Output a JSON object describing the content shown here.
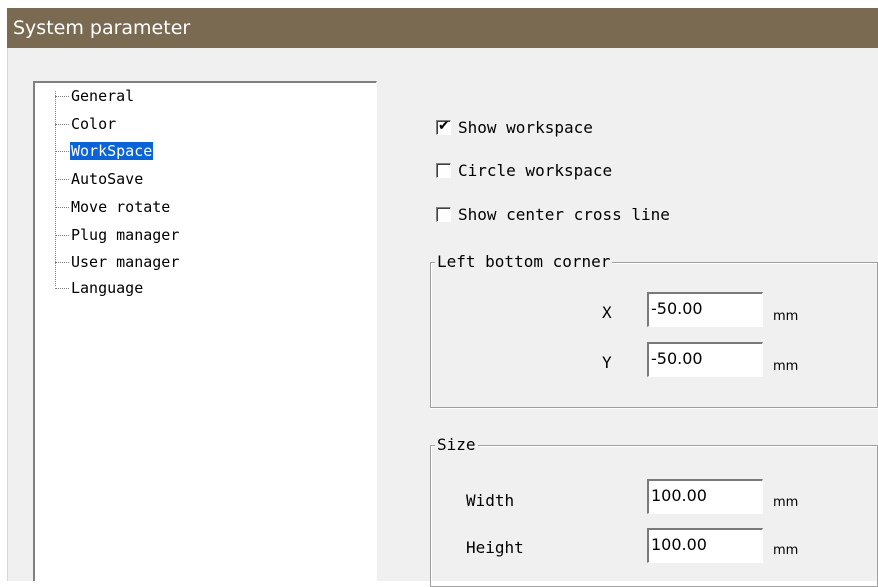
{
  "window": {
    "title": "System parameter"
  },
  "tree": {
    "items": [
      {
        "label": "General"
      },
      {
        "label": "Color"
      },
      {
        "label": "WorkSpace",
        "selected": true
      },
      {
        "label": "AutoSave"
      },
      {
        "label": "Move rotate"
      },
      {
        "label": "Plug manager"
      },
      {
        "label": "User manager"
      },
      {
        "label": "Language"
      }
    ]
  },
  "options": {
    "show_workspace": {
      "label": "Show workspace",
      "checked": true
    },
    "circle_workspace": {
      "label": "Circle workspace",
      "checked": false
    },
    "show_center_cross": {
      "label": "Show center cross line",
      "checked": false
    }
  },
  "corner": {
    "legend": "Left bottom corner",
    "x_label": "X",
    "x_value": "-50.00",
    "x_unit": "mm",
    "y_label": "Y",
    "y_value": "-50.00",
    "y_unit": "mm"
  },
  "size": {
    "legend": "Size",
    "width_label": "Width",
    "width_value": "100.00",
    "width_unit": "mm",
    "height_label": "Height",
    "height_value": "100.00",
    "height_unit": "mm"
  },
  "colors": {
    "titlebar": "#7a6a52",
    "selection": "#0a64d8",
    "dialog_bg": "#f0f0f0"
  }
}
